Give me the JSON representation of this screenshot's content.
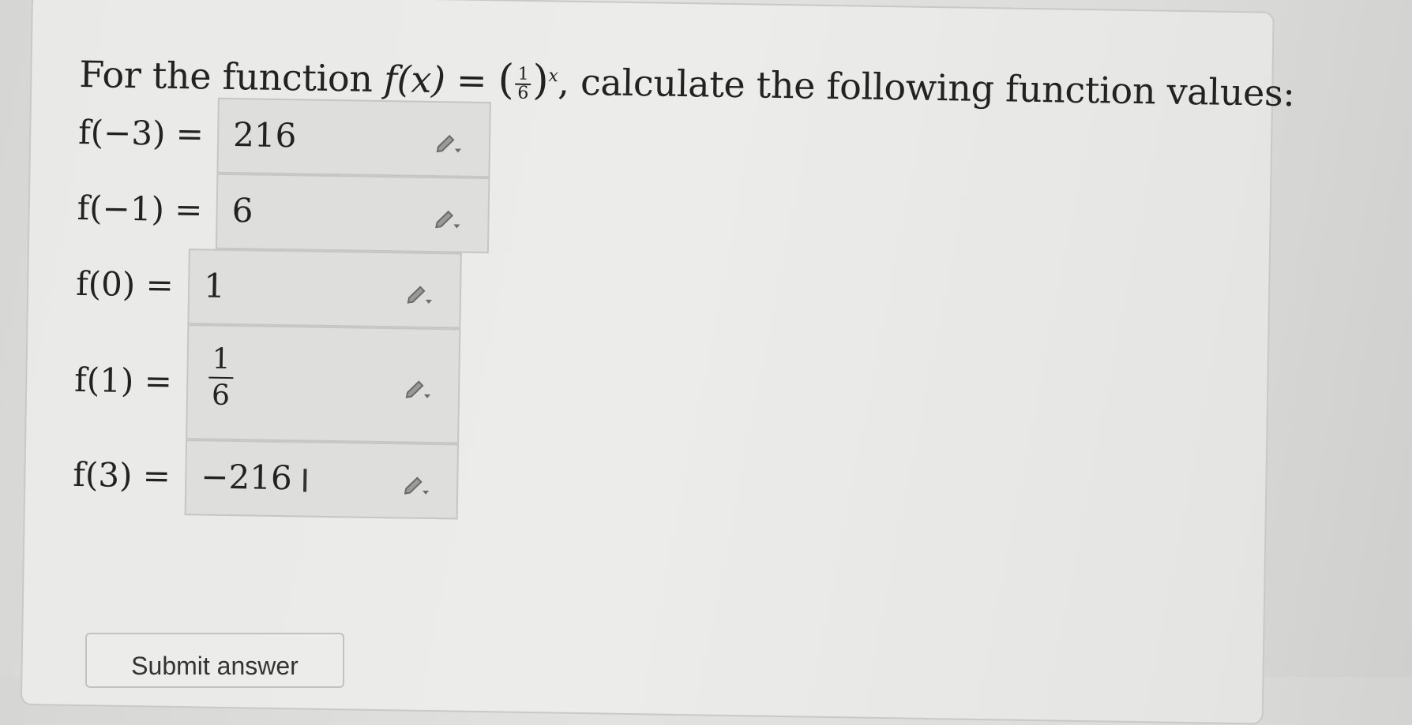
{
  "question": {
    "intro": "For the function",
    "func_lhs": "f(x) = ",
    "frac_num": "1",
    "frac_den": "6",
    "exponent": "x",
    "tail": ", calculate the following function values:"
  },
  "answers": [
    {
      "label": "f(−3) =",
      "value": "216"
    },
    {
      "label": "f(−1) =",
      "value": "6"
    },
    {
      "label": "f(0) =",
      "value": "1"
    },
    {
      "label": "f(1) =",
      "value_num": "1",
      "value_den": "6"
    },
    {
      "label": "f(3) =",
      "value": "−216"
    }
  ],
  "cursor_glyph": "I",
  "submit_label": "Submit answer",
  "icons": {
    "edit": "pencil-dropdown-icon"
  }
}
